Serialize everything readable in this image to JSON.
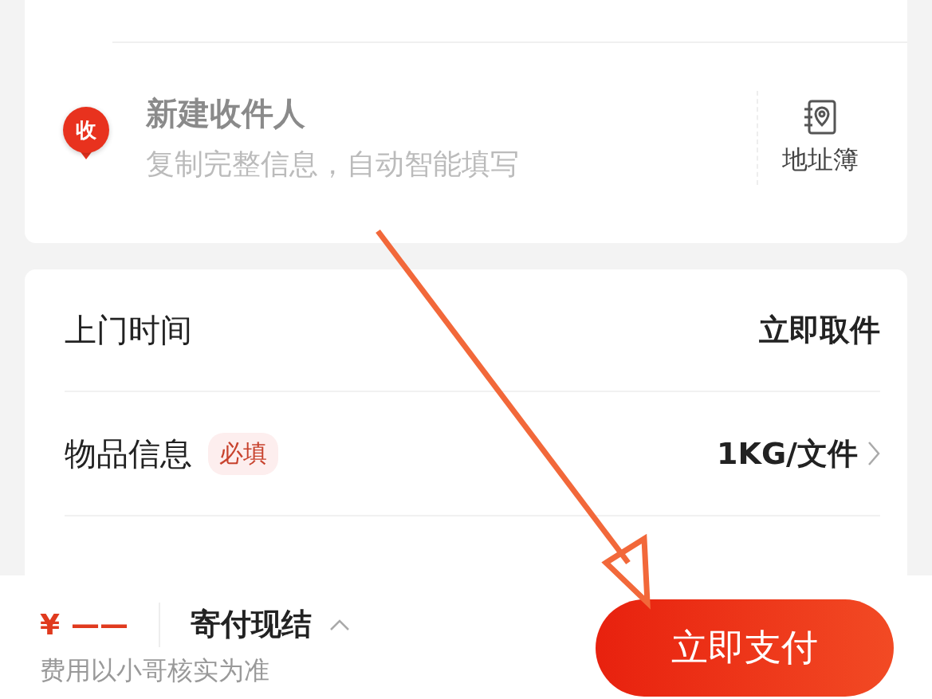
{
  "recipient": {
    "badge": "收",
    "title": "新建收件人",
    "hint": "复制完整信息，自动智能填写"
  },
  "address_book": {
    "label": "地址簿"
  },
  "rows": [
    {
      "kind": "value",
      "label": "上门时间",
      "value": "立即取件"
    },
    {
      "kind": "link",
      "label": "物品信息",
      "tag": "必填",
      "value": "1KG/文件"
    }
  ],
  "footer": {
    "currency": "¥",
    "price": "——",
    "payment": "寄付现结",
    "note": "费用以小哥核实为准",
    "submit": "立即支付"
  }
}
